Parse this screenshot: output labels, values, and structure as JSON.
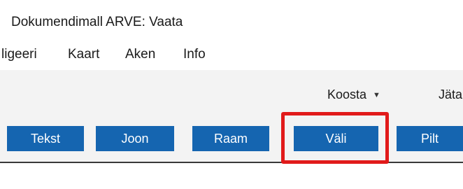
{
  "window": {
    "title": "Dokumendimall ARVE: Vaata"
  },
  "menu": {
    "items": [
      {
        "label": "ligeeri"
      },
      {
        "label": "Kaart"
      },
      {
        "label": "Aken"
      },
      {
        "label": "Info"
      }
    ]
  },
  "toolbar": {
    "koosta_label": "Koosta",
    "koosta_caret": "▼",
    "jata_label": "Jäta",
    "buttons": [
      {
        "label": "Tekst"
      },
      {
        "label": "Joon"
      },
      {
        "label": "Raam"
      },
      {
        "label": "Väli"
      },
      {
        "label": "Pilt"
      }
    ],
    "button_color": "#1565b0",
    "highlight_color": "#e11a1a",
    "highlighted_button": "Väli"
  }
}
